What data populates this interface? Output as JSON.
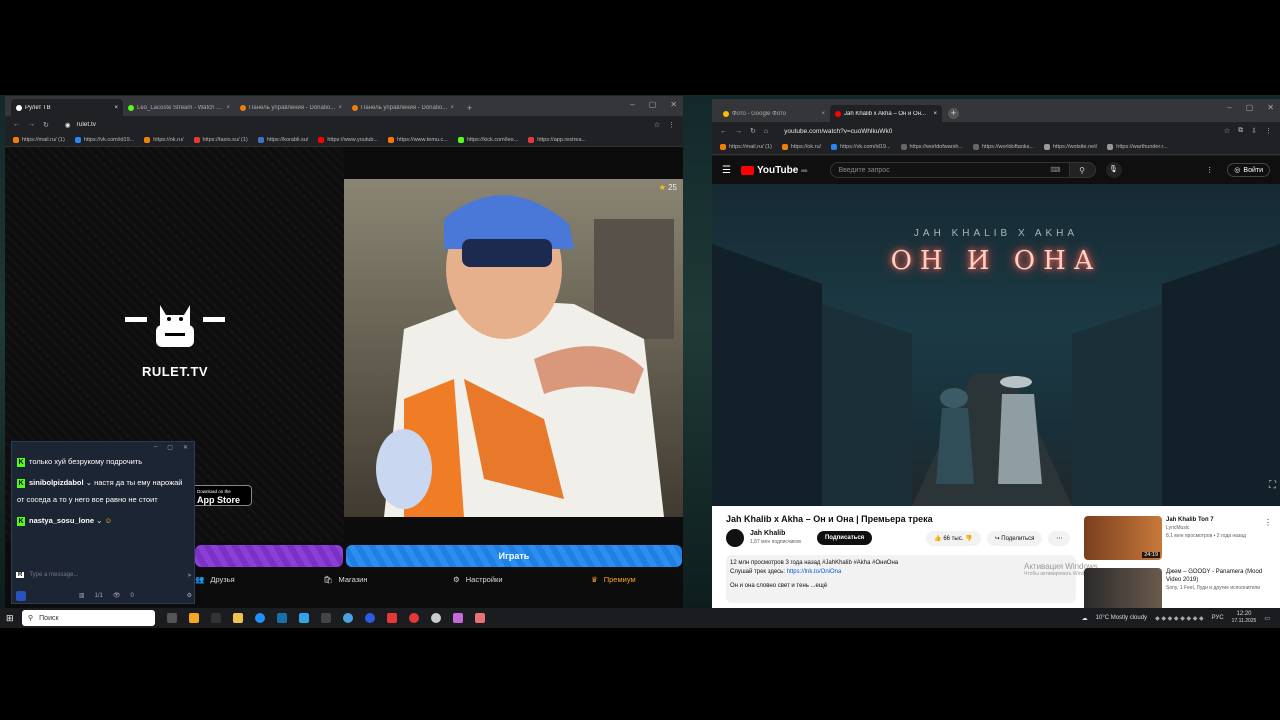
{
  "browser1": {
    "tabs": [
      {
        "label": "Рулет ТВ",
        "active": true,
        "color": "#ffffff"
      },
      {
        "label": "Leo_Lacoste Stream - Watch Le...",
        "active": false,
        "color": "#53fc18"
      },
      {
        "label": "Панель управления - Donatio...",
        "active": false,
        "color": "#f57d07"
      },
      {
        "label": "Панель управления - Donatio...",
        "active": false,
        "color": "#f57d07"
      }
    ],
    "url": "rulet.tv",
    "bookmarks": [
      "https://mail.ru/ (1)",
      "https://vk.com/id19...",
      "https://ok.ru/",
      "https://taxio.su/ (1)",
      "https://korabli.su/",
      "https://www.youtub...",
      "https://www.temu.c...",
      "https://kick.com/leo...",
      "https://app.restrea..."
    ]
  },
  "rulet": {
    "logo_text": "RULET.TV",
    "viewer_count": "25",
    "app_store_small": "Download on the",
    "app_store_label": "App Store",
    "play_btn_label": "Играть",
    "nav": {
      "friends": "Друзья",
      "shop": "Магазин",
      "settings": "Настройки",
      "premium": "Премиум"
    }
  },
  "chat": {
    "messages": [
      {
        "user": "",
        "text": "только хуй безрукому подрочить"
      },
      {
        "user": "sinibolpizdabol",
        "text": "настя да ты ему нарожай от соседа а то у него все равно не стоит"
      },
      {
        "user": "nastya_sosu_lone",
        "text": ""
      }
    ],
    "input_placeholder": "Type a message...",
    "footer_count": "1/1",
    "footer_viewers": "0"
  },
  "browser2": {
    "tabs": [
      {
        "label": "Фото - Google Фото",
        "active": false,
        "color": "#fbbc04"
      },
      {
        "label": "Jah Khalib x Akha – Он и Он...",
        "active": true,
        "color": "#ff0000"
      }
    ],
    "url": "youtube.com/watch?v=cuoWhlkuWk0",
    "bookmarks": [
      "https://mail.ru/ (1)",
      "https://ok.ru/",
      "https://vk.com/id19...",
      "https://worldofwarsh...",
      "https://worldoftanks...",
      "https://wotsite.net/",
      "https://warthunder.r..."
    ]
  },
  "youtube": {
    "logo": "YouTube",
    "logo_region": "MD",
    "search_placeholder": "Введите запрос",
    "sign_in": "Войти",
    "video_subtitle": "JAH KHALIB X AKHA",
    "video_title_art": "ОН И ОНА",
    "title": "Jah Khalib x Akha – Он и Она | Премьера трека",
    "channel": "Jah Khalib",
    "subscribers": "1,87 млн подписчиков",
    "subscribe": "Подписаться",
    "likes": "66 тыс.",
    "share": "Поделиться",
    "views_line": "12 млн просмотров  3 года назад  #JahKhalib #Akha #ОниОна",
    "listen_line": "Слушай трек здесь:",
    "listen_link": "https://lnk.to/OniOna",
    "desc_line": "Он и она словно свет и тень   ...ещё",
    "watermark": "Активация Windows",
    "watermark_sub": "Чтобы активировать Windows, перейдите в раздел",
    "recommended": [
      {
        "title": "Jah Khalib Топ 7",
        "channel": "LyricMusic",
        "meta": "8,1 млн просмотров • 2 года назад",
        "duration": "24:19"
      },
      {
        "title": "Джем – GOODY - Panamera (Mood Video 2019)",
        "channel": "Sony, 1 Feel, Луди и другие исполнители",
        "meta": "",
        "duration": ""
      }
    ]
  },
  "taskbar": {
    "search": "Поиск",
    "weather": "10°C  Mostly cloudy",
    "lang": "РУС",
    "time": "12:20",
    "date": "17.11.2025"
  }
}
